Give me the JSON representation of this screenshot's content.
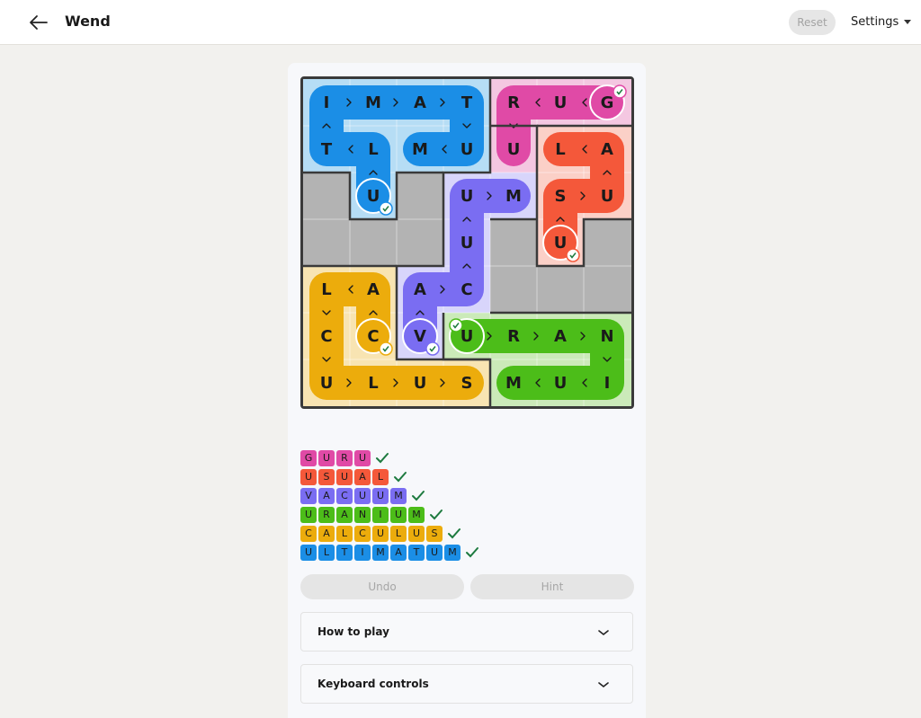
{
  "header": {
    "title": "Wend",
    "reset_label": "Reset",
    "settings_label": "Settings"
  },
  "board": {
    "rows": 7,
    "cols": 7,
    "letters": [
      [
        "I",
        "M",
        "A",
        "T",
        "R",
        "U",
        "G"
      ],
      [
        "T",
        "L",
        "M",
        "U",
        "U",
        "L",
        "A"
      ],
      [
        "",
        "U",
        "",
        "U",
        "M",
        "S",
        "U"
      ],
      [
        "",
        "",
        "",
        "U",
        "",
        "U",
        ""
      ],
      [
        "L",
        "A",
        "A",
        "C",
        "",
        "",
        ""
      ],
      [
        "C",
        "C",
        "V",
        "U",
        "R",
        "A",
        "N"
      ],
      [
        "U",
        "L",
        "U",
        "S",
        "M",
        "U",
        "I"
      ]
    ]
  },
  "words": [
    {
      "word": "GURU",
      "color": "#e04aa6",
      "letters": [
        "G",
        "U",
        "R",
        "U"
      ]
    },
    {
      "word": "USUAL",
      "color": "#f4583a",
      "letters": [
        "U",
        "S",
        "U",
        "A",
        "L"
      ]
    },
    {
      "word": "VACUUM",
      "color": "#7a6df2",
      "letters": [
        "V",
        "A",
        "C",
        "U",
        "U",
        "M"
      ]
    },
    {
      "word": "URANIUM",
      "color": "#4cbd19",
      "letters": [
        "U",
        "R",
        "A",
        "N",
        "I",
        "U",
        "M"
      ]
    },
    {
      "word": "CALCULUS",
      "color": "#ecac0c",
      "letters": [
        "C",
        "A",
        "L",
        "C",
        "U",
        "L",
        "U",
        "S"
      ]
    },
    {
      "word": "ULTIMATUM",
      "color": "#1b8ee6",
      "letters": [
        "U",
        "L",
        "T",
        "I",
        "M",
        "A",
        "T",
        "U",
        "M"
      ]
    }
  ],
  "controls": {
    "undo_label": "Undo",
    "hint_label": "Hint"
  },
  "accordions": {
    "how_to_play": "How to play",
    "keyboard_controls": "Keyboard controls"
  },
  "colors": {
    "check": "#1d7a3f",
    "blocked": "#b3b3b3",
    "border": "#3a3a3a"
  }
}
